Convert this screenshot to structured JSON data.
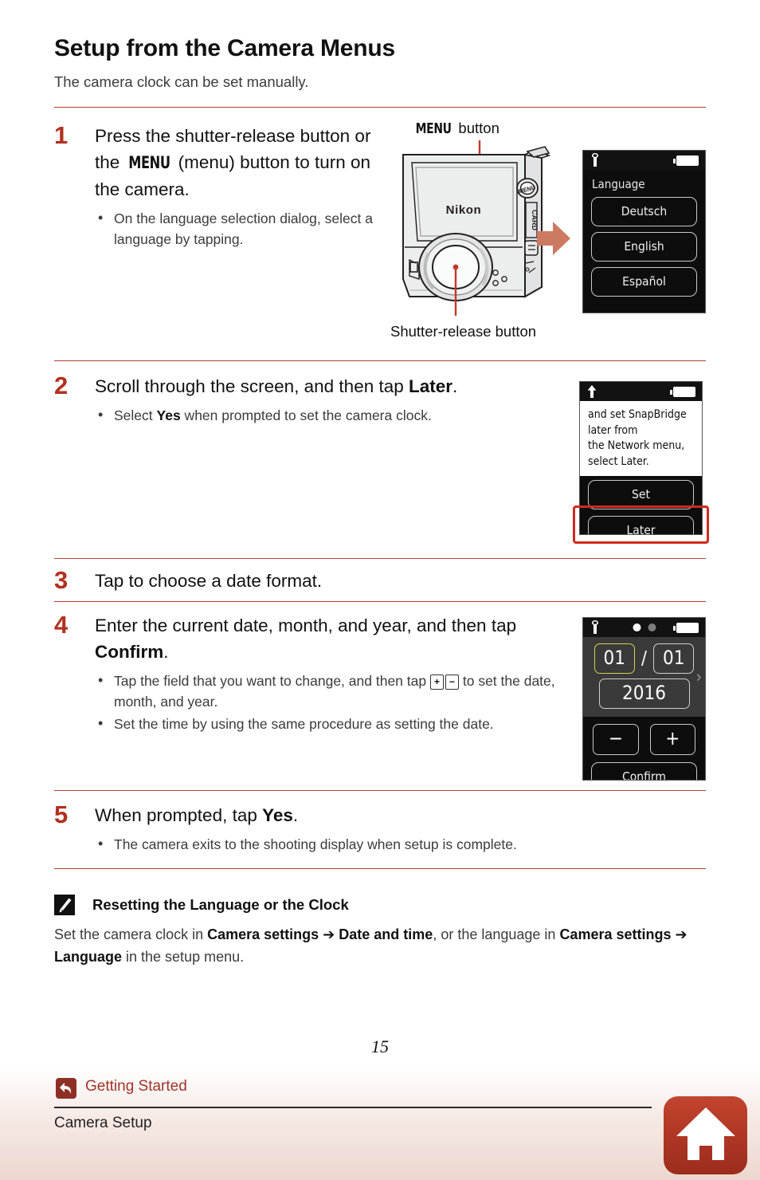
{
  "header": {
    "title": "Setup from the Camera Menus",
    "subtitle": "The camera clock can be set manually."
  },
  "colors": {
    "accent_red": "#b2301f",
    "rule_red": "#b5412f",
    "highlight_red": "#cf2a20",
    "arrow_salmon": "#cd7a62",
    "footer_link": "#a03528",
    "selected_field_yellow": "#d6d14a"
  },
  "steps": [
    {
      "number": "1",
      "heading_parts": [
        "Press the shutter-release button or the ",
        "MENU",
        " (menu) button to turn on the camera."
      ],
      "bullets": [
        "On the language selection dialog, select a language by tapping."
      ]
    },
    {
      "number": "2",
      "heading_parts": [
        "Scroll through the screen, and then tap ",
        "Later",
        "."
      ],
      "bullets": [
        "Select Yes when prompted to set the camera clock."
      ],
      "bullet_bold": "Yes"
    },
    {
      "number": "3",
      "heading_parts": [
        "Tap to choose a date format."
      ],
      "bullets": []
    },
    {
      "number": "4",
      "heading_parts": [
        "Enter the current date, month, and year, and then tap ",
        "Confirm",
        "."
      ],
      "bullets": [
        "Tap the field that you want to change, and then tap + - to set the date, month, and year.",
        "Set the time by using the same procedure as setting the date."
      ],
      "key_plus": "+",
      "key_minus": "−"
    },
    {
      "number": "5",
      "heading_parts": [
        "When prompted, tap ",
        "Yes",
        "."
      ],
      "bullets": [
        "The camera exits to the shooting display when setup is complete."
      ]
    }
  ],
  "camera_figure": {
    "menu_button_label_word": "MENU",
    "menu_button_label_rest": " button",
    "shutter_label": "Shutter-release button",
    "brand": "Nikon",
    "port_label": "CARD",
    "button_text": "MENU"
  },
  "screen_language": {
    "status_icon": "wrench-icon",
    "battery_icon": "battery-icon",
    "title": "Language",
    "options": [
      "Deutsch",
      "English",
      "Español"
    ]
  },
  "screen_snapbridge": {
    "status_icon": "up-arrow-icon",
    "battery_icon": "battery-icon",
    "message_lines": [
      "and set SnapBridge",
      "later from",
      "the Network menu,",
      "select Later."
    ],
    "buttons": [
      "Set",
      "Later"
    ],
    "highlighted_button": "Later"
  },
  "screen_date": {
    "status_icon": "wrench-icon",
    "battery_icon": "battery-icon",
    "page_dots": [
      "on",
      "off"
    ],
    "day": "01",
    "separator": "/",
    "month": "01",
    "year": "2016",
    "selected_field": "day",
    "next_chevron": "›",
    "minus_label": "−",
    "plus_label": "+",
    "confirm_label": "Confirm"
  },
  "note": {
    "icon": "pencil-icon",
    "title": "Resetting the Language or the Clock",
    "text_segments": [
      {
        "t": "Set the camera clock in ",
        "b": false
      },
      {
        "t": "Camera settings",
        "b": true
      },
      {
        "t": " ➔ ",
        "b": true
      },
      {
        "t": "Date and time",
        "b": true
      },
      {
        "t": ", or the language in ",
        "b": false
      },
      {
        "t": "Camera settings",
        "b": true
      },
      {
        "t": " ➔ ",
        "b": true
      },
      {
        "t": "Language",
        "b": true
      },
      {
        "t": " in the setup menu.",
        "b": false
      }
    ]
  },
  "footer": {
    "page_number": "15",
    "back_link": "Getting Started",
    "section": "Camera Setup",
    "home_icon": "home-icon",
    "back_icon": "back-arrow-icon"
  }
}
